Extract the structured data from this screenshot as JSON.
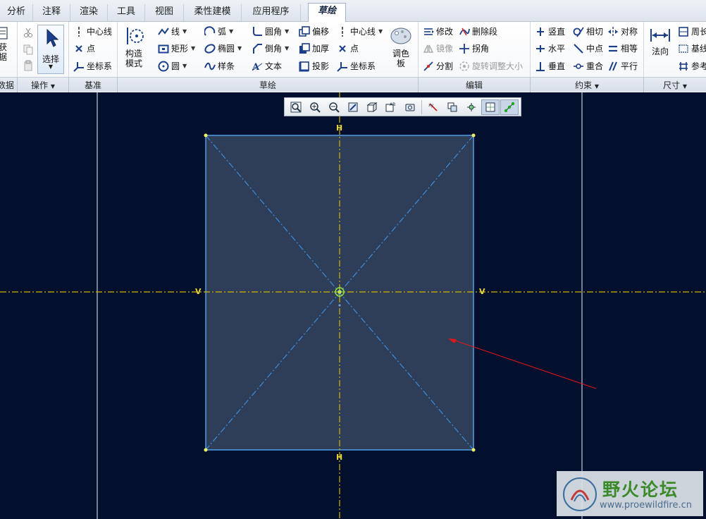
{
  "tabs": [
    {
      "label": "分析"
    },
    {
      "label": "注释"
    },
    {
      "label": "渲染"
    },
    {
      "label": "工具"
    },
    {
      "label": "视图"
    },
    {
      "label": "柔性建模"
    },
    {
      "label": "应用程序"
    },
    {
      "label": "草绘",
      "active": true
    }
  ],
  "groups": {
    "data": "数据",
    "operations": "操作",
    "datum": "基准",
    "sketch": "草绘",
    "edit": "编辑",
    "constraint": "约束",
    "dimension": "尺寸"
  },
  "data_group": {
    "big_label_top": "获",
    "big_label_bottom": "据"
  },
  "operations": {
    "select_label": "选择"
  },
  "datum": {
    "centerline": "中心线",
    "point": "点",
    "csys": "坐标系"
  },
  "construction_mode": {
    "label_line1": "构造",
    "label_line2": "模式"
  },
  "sketch": {
    "line": "线",
    "arc": "弧",
    "fillet": "圆角",
    "offset": "偏移",
    "centerline": "中心线",
    "rectangle": "矩形",
    "ellipse": "椭圆",
    "chamfer": "倒角",
    "thicken": "加厚",
    "point": "点",
    "circle": "圆",
    "spline": "样条",
    "text": "文本",
    "project": "投影",
    "csys": "坐标系",
    "palette_line1": "调色",
    "palette_line2": "板"
  },
  "edit": {
    "modify": "修改",
    "delete_segment": "删除段",
    "mirror": "镜像",
    "corner": "拐角",
    "divide": "分割",
    "rotate_resize": "旋转调整大小"
  },
  "constraint": {
    "vertical": "竖直",
    "tangent": "相切",
    "symmetric": "对称",
    "horizontal": "水平",
    "midpoint": "中点",
    "equal": "相等",
    "perpendicular": "垂直",
    "coincident": "重合",
    "parallel": "平行"
  },
  "dimension": {
    "normal": "法向",
    "perimeter": "周长",
    "baseline": "基线",
    "reference": "参考"
  },
  "canvas": {
    "h_marker": "H",
    "v_marker": "V",
    "background_color": "#02102e",
    "sketch_fill": "#2e3d58",
    "sketch_line_color": "#5ab0ff",
    "axis_color": "#d6b400",
    "arrow_color": "#e01818"
  },
  "watermark": {
    "title": "野火论坛",
    "url": "www.proewildfire.cn"
  },
  "icons": [
    "zoom-fit-icon",
    "zoom-in-icon",
    "zoom-out-icon",
    "repaint-icon",
    "display-style-icon",
    "saved-view-icon",
    "sketch-view-icon",
    "datum-display-icon",
    "dimension-display-icon",
    "constraint-display-icon",
    "grid-display-icon",
    "vertex-display-icon"
  ]
}
